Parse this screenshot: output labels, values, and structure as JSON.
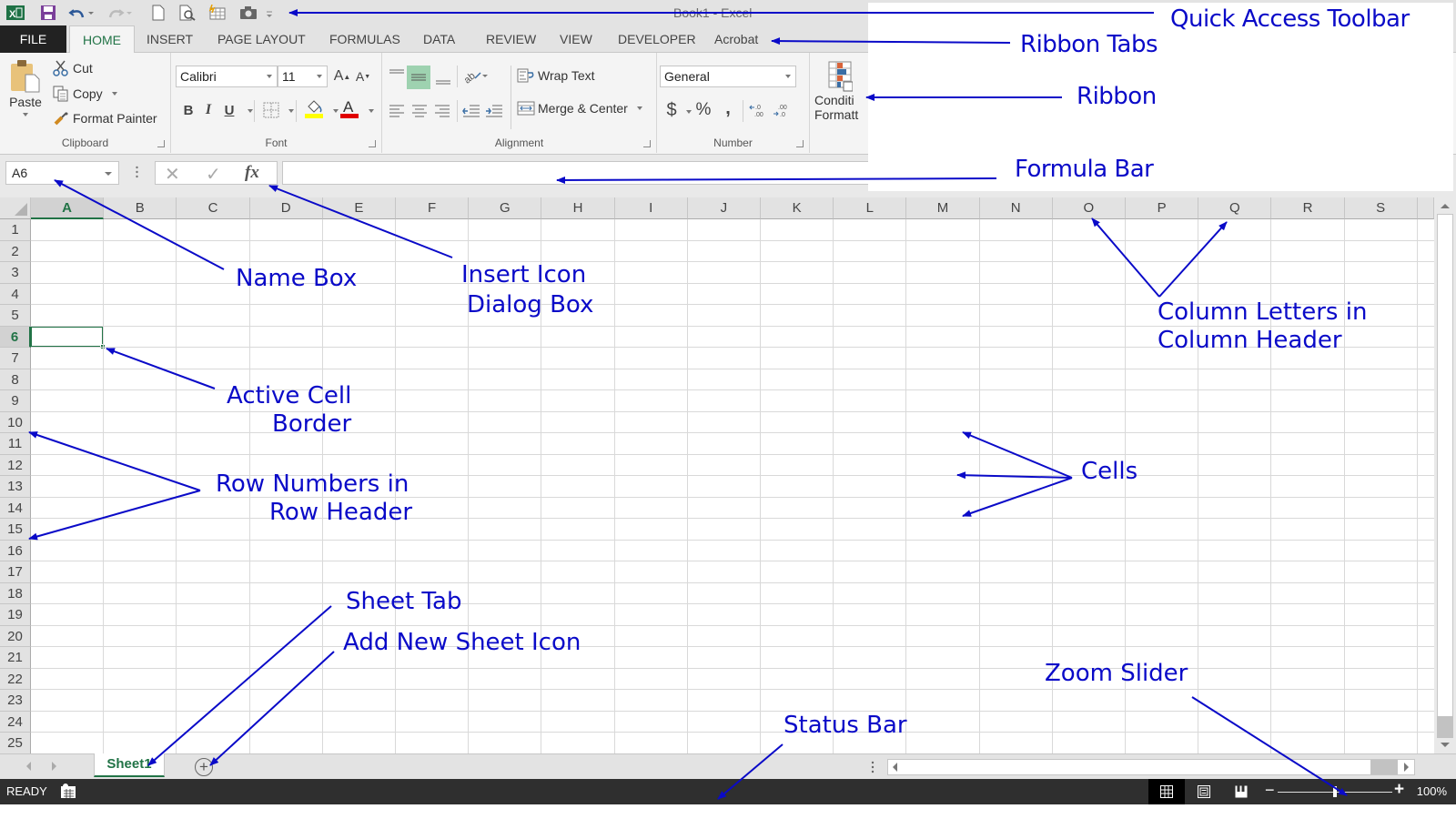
{
  "window": {
    "title": "Book1 - Excel"
  },
  "quick_access_toolbar": {
    "items": [
      {
        "icon": "excel-logo-icon"
      },
      {
        "icon": "save-icon"
      },
      {
        "icon": "undo-icon"
      },
      {
        "icon": "redo-icon"
      },
      {
        "icon": "new-document-icon"
      },
      {
        "icon": "print-preview-icon"
      },
      {
        "icon": "quick-chart-icon"
      },
      {
        "icon": "camera-icon"
      },
      {
        "icon": "customize-toolbar-icon"
      }
    ]
  },
  "ribbon_tabs": {
    "file": "FILE",
    "tabs": [
      "HOME",
      "INSERT",
      "PAGE LAYOUT",
      "FORMULAS",
      "DATA",
      "REVIEW",
      "VIEW",
      "DEVELOPER",
      "Acrobat"
    ],
    "active": "HOME"
  },
  "ribbon": {
    "clipboard": {
      "label": "Clipboard",
      "paste": "Paste",
      "cut": "Cut",
      "copy": "Copy",
      "format_painter": "Format Painter"
    },
    "font": {
      "label": "Font",
      "font_name": "Calibri",
      "font_size": "11",
      "grow": "A",
      "shrink": "A",
      "bold": "B",
      "italic": "I",
      "underline": "U",
      "fill_color": "#ffff00",
      "font_color": "#e00000"
    },
    "alignment": {
      "label": "Alignment",
      "wrap_text": "Wrap Text",
      "merge_center": "Merge & Center"
    },
    "number": {
      "label": "Number",
      "format": "General",
      "currency": "$",
      "percent": "%",
      "comma": ","
    },
    "styles": {
      "conditional_formatting_line1": "Conditi",
      "conditional_formatting_line2": "Formatt"
    }
  },
  "formula_bar": {
    "name_box": "A6",
    "cancel": "✕",
    "enter": "✓",
    "fx": "fx",
    "formula": ""
  },
  "grid": {
    "columns": [
      "A",
      "B",
      "C",
      "D",
      "E",
      "F",
      "G",
      "H",
      "I",
      "J",
      "K",
      "L",
      "M",
      "N",
      "O",
      "P",
      "Q",
      "R",
      "S"
    ],
    "rows": [
      "1",
      "2",
      "3",
      "4",
      "5",
      "6",
      "7",
      "8",
      "9",
      "10",
      "11",
      "12",
      "13",
      "14",
      "15",
      "16",
      "17",
      "18",
      "19",
      "20",
      "21",
      "22",
      "23",
      "24",
      "25"
    ],
    "active_cell": "A6",
    "accent": "#217346"
  },
  "sheets": {
    "tabs": [
      "Sheet1"
    ],
    "active": "Sheet1",
    "add_sheet": "+"
  },
  "status_bar": {
    "mode": "READY",
    "zoom_percent": "100%",
    "zoom_level": 100
  },
  "annotations": {
    "color": "#0a0ac8",
    "quick_access_toolbar": "Quick Access Toolbar",
    "ribbon_tabs": "Ribbon Tabs",
    "ribbon": "Ribbon",
    "formula_bar": "Formula Bar",
    "name_box": "Name Box",
    "insert_icon_1": "Insert Icon",
    "insert_icon_2": "Dialog Box",
    "column_letters_1": "Column Letters in",
    "column_letters_2": "Column Header",
    "active_cell_1": "Active Cell",
    "active_cell_2": "Border",
    "row_numbers_1": "Row Numbers in",
    "row_numbers_2": "Row Header",
    "cells": "Cells",
    "sheet_tab": "Sheet Tab",
    "add_new_sheet": "Add New Sheet Icon",
    "status_bar": "Status Bar",
    "zoom_slider": "Zoom Slider"
  }
}
